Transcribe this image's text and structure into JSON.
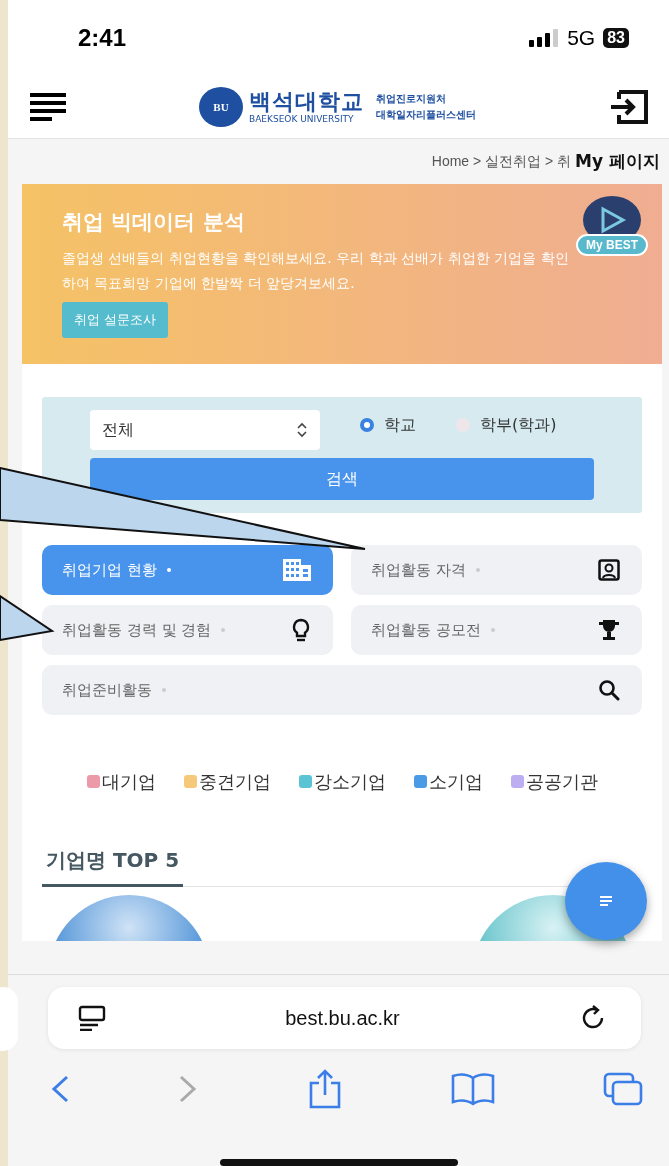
{
  "status_bar": {
    "time": "2:41",
    "network": "5G",
    "battery": "83"
  },
  "header": {
    "logo_badge": "BU",
    "logo_name": "백석대학교",
    "logo_sub": "BAEKSEOK UNIVERSITY",
    "center_lines": [
      "취업진로지원처",
      "대학일자리플러스센터"
    ]
  },
  "breadcrumb": "Home > 실전취업 > 취",
  "annotation": "My 페이지",
  "banner": {
    "title": "취업 빅데이터 분석",
    "description": "졸업생 선배들의 취업현황을 확인해보세요. 우리 학과 선배가 취업한 기업을 확인하여 목표희망 기업에 한발짝 더 앞당겨보세요.",
    "button": "취업 설문조사",
    "badge": "My BEST"
  },
  "search": {
    "select_value": "전체",
    "radios": [
      {
        "label": "학교",
        "selected": true
      },
      {
        "label": "학부(학과)",
        "selected": false
      }
    ],
    "button": "검색"
  },
  "tiles": [
    {
      "label": "취업기업 현황",
      "selected": true,
      "kind": "building"
    },
    {
      "label": "취업활동 자격",
      "selected": false,
      "kind": "portrait"
    },
    {
      "label": "취업활동 경력 및 경험",
      "selected": false,
      "kind": "bulb"
    },
    {
      "label": "취업활동 공모전",
      "selected": false,
      "kind": "trophy"
    },
    {
      "label": "취업준비활동",
      "selected": false,
      "kind": "search"
    }
  ],
  "legend": [
    {
      "label": "대기업",
      "color": "#ec9aa8"
    },
    {
      "label": "중견기업",
      "color": "#f6c97a"
    },
    {
      "label": "강소기업",
      "color": "#5bc4d4"
    },
    {
      "label": "소기업",
      "color": "#4a9ae6"
    },
    {
      "label": "공공기관",
      "color": "#bdaef2"
    }
  ],
  "section_title": "기업명 TOP 5",
  "browser": {
    "url": "best.bu.ac.kr"
  }
}
